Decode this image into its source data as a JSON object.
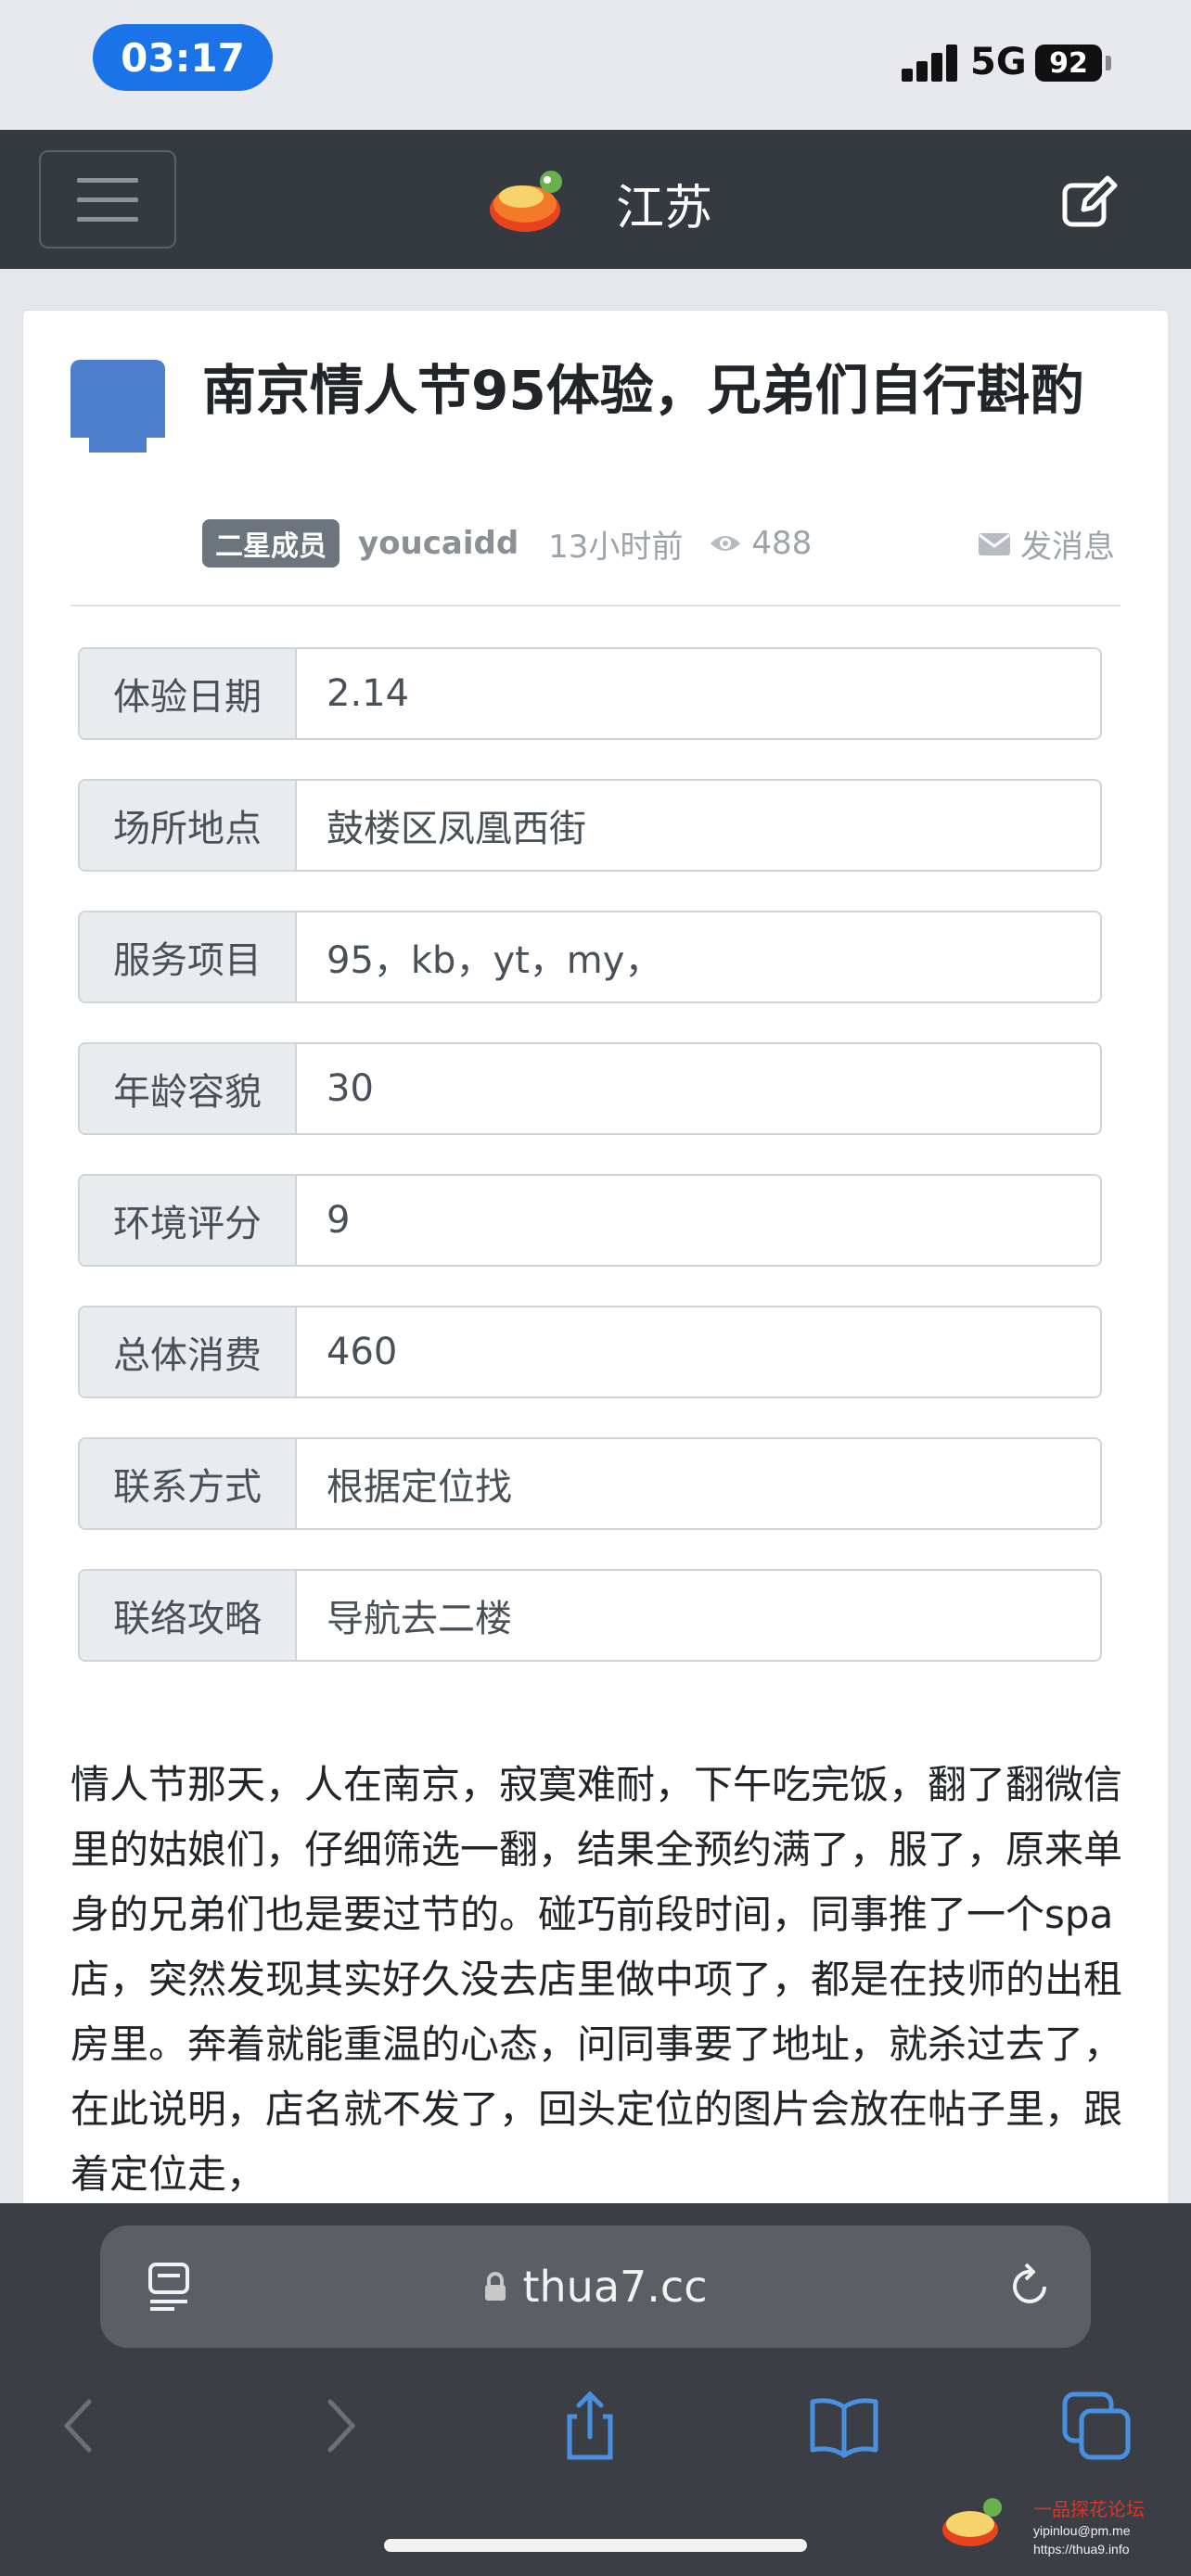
{
  "status_bar": {
    "time": "03:17",
    "network": "5G",
    "battery": "92"
  },
  "navbar": {
    "title": "江苏"
  },
  "post": {
    "title": "南京情人节95体验，兄弟们自行斟酌",
    "badge": "二星成员",
    "username": "youcaidd",
    "time_ago": "13小时前",
    "views": "488",
    "message_label": "发消息",
    "fields": [
      {
        "label": "体验日期",
        "value": "2.14"
      },
      {
        "label": "场所地点",
        "value": "鼓楼区凤凰西街"
      },
      {
        "label": "服务项目",
        "value": "95，kb，yt，my，"
      },
      {
        "label": "年龄容貌",
        "value": "30"
      },
      {
        "label": "环境评分",
        "value": "9"
      },
      {
        "label": "总体消费",
        "value": "460"
      },
      {
        "label": "联系方式",
        "value": "根据定位找"
      },
      {
        "label": "联络攻略",
        "value": "导航去二楼"
      }
    ],
    "body": "情人节那天，人在南京，寂寞难耐，下午吃完饭，翻了翻微信里的姑娘们，仔细筛选一翻，结果全预约满了，服了，原来单身的兄弟们也是要过节的。碰巧前段时间，同事推了一个spa店，突然发现其实好久没去店里做中项了，都是在技师的出租房里。奔着就能重温的心态，问同事要了地址，就杀过去了，在此说明，店名就不发了，回头定位的图片会放在帖子里，跟着定位走，"
  },
  "browser": {
    "url": "thua7.cc"
  },
  "watermark": {
    "title": "一品探花论坛",
    "email": "yipinlou@pm.me",
    "site": "https://thua9.info"
  }
}
